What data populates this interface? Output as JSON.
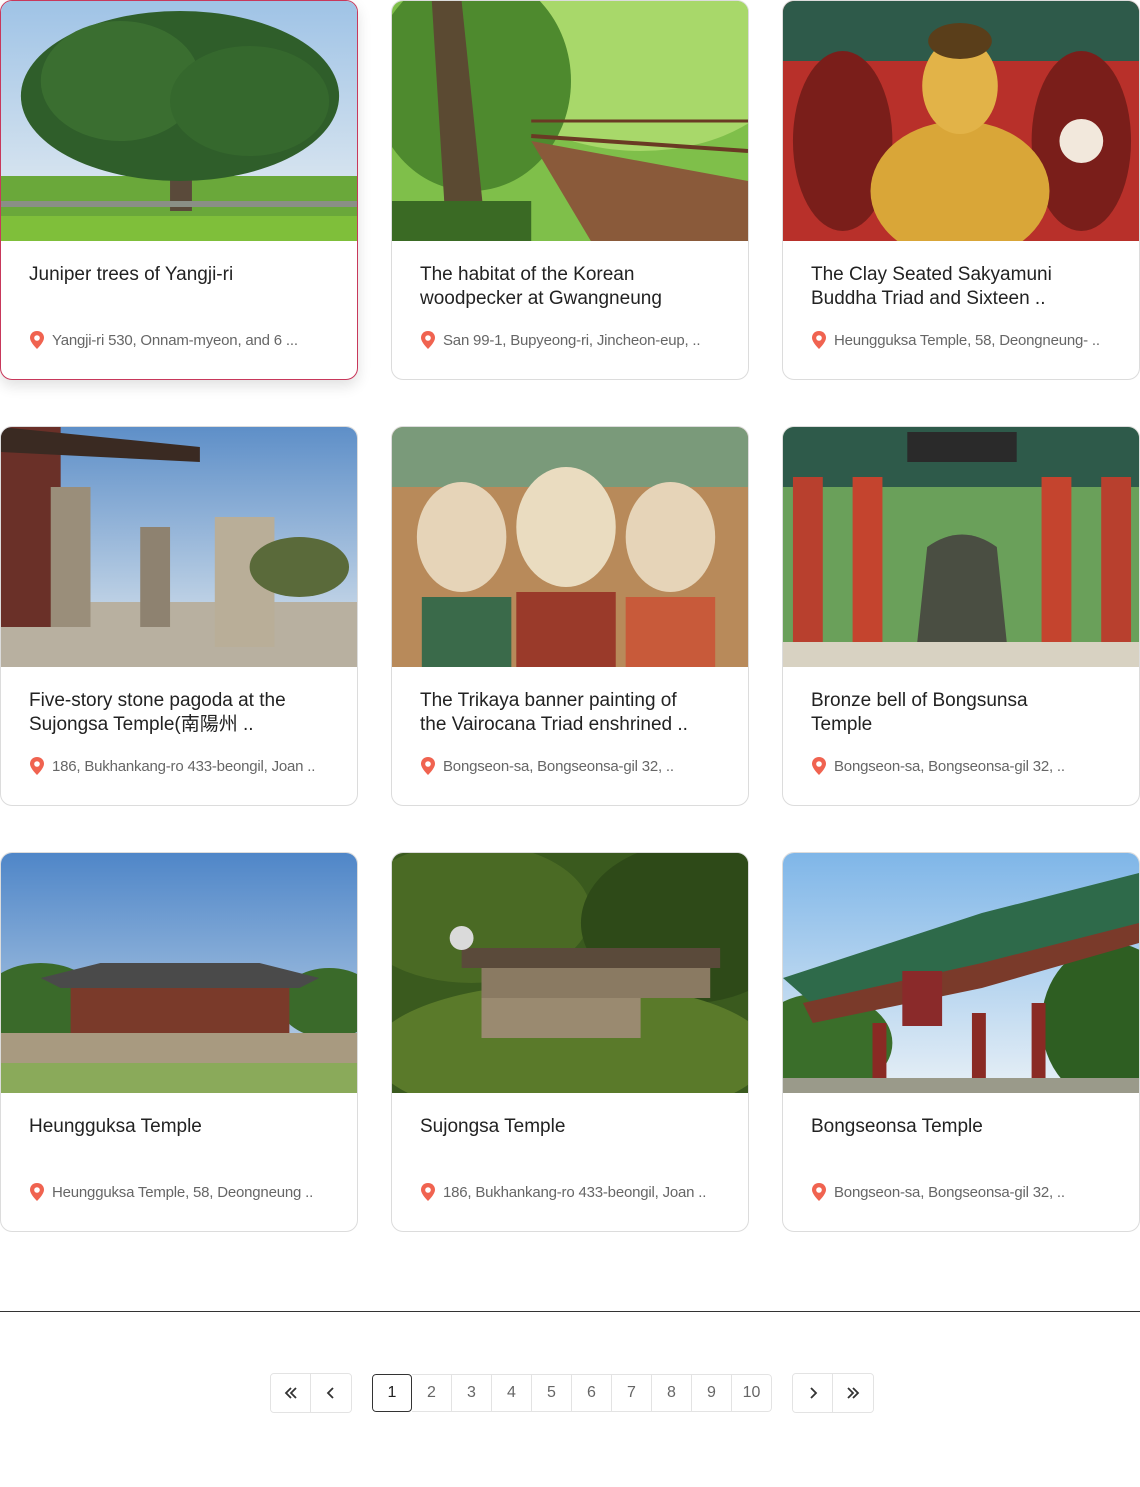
{
  "colors": {
    "accent": "#c8385b",
    "pin": "#f06350",
    "title": "#222222",
    "address": "#666666",
    "border": "#dcdcdc"
  },
  "cards": [
    {
      "title": "Juniper trees of Yangji-ri",
      "address": "Yangji-ri 530, Onnam-myeon, and 6 ...",
      "image": "juniper-tree-photo"
    },
    {
      "title": "The habitat of the Korean woodpecker at Gwangneung",
      "address": "San 99-1, Bupyeong-ri, Jincheon-eup, ..",
      "image": "forest-boardwalk-photo"
    },
    {
      "title": "The Clay Seated Sakyamuni Buddha Triad and Sixteen ..",
      "address": "Heungguksa Temple, 58, Deongneung- ..",
      "image": "golden-buddha-photo"
    },
    {
      "title": "Five-story stone pagoda at the Sujongsa Temple(南陽州 ..",
      "address": "186, Bukhankang-ro 433-beongil, Joan ..",
      "image": "stone-pagoda-photo"
    },
    {
      "title": "The Trikaya banner painting of the Vairocana Triad enshrined ..",
      "address": "Bongseon-sa, Bongseonsa-gil 32,  ..",
      "image": "buddhist-painting-photo"
    },
    {
      "title": "Bronze bell of Bongsunsa Temple",
      "address": "Bongseon-sa, Bongseonsa-gil 32,  ..",
      "image": "bronze-bell-photo"
    },
    {
      "title": "Heungguksa Temple",
      "address": "Heungguksa Temple, 58, Deongneung ..",
      "image": "heungguksa-temple-photo"
    },
    {
      "title": "Sujongsa Temple",
      "address": "186, Bukhankang-ro 433-beongil, Joan ..",
      "image": "sujongsa-temple-photo"
    },
    {
      "title": "Bongseonsa Temple",
      "address": "Bongseon-sa, Bongseonsa-gil 32, ..",
      "image": "bongseonsa-temple-photo"
    }
  ],
  "pagination": {
    "first_icon": "double-chevron-left-icon",
    "prev_icon": "chevron-left-icon",
    "next_icon": "chevron-right-icon",
    "last_icon": "double-chevron-right-icon",
    "pages": [
      "1",
      "2",
      "3",
      "4",
      "5",
      "6",
      "7",
      "8",
      "9",
      "10"
    ],
    "current": "1"
  }
}
